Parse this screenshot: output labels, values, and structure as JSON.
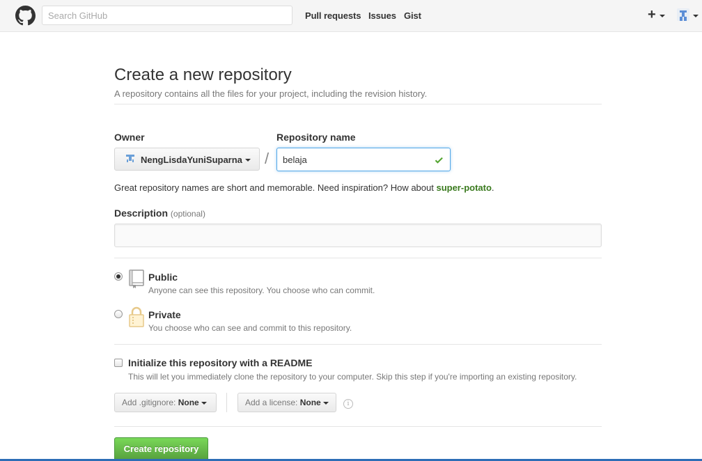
{
  "header": {
    "search_placeholder": "Search GitHub",
    "nav": {
      "pull_requests": "Pull requests",
      "issues": "Issues",
      "gist": "Gist"
    },
    "new_menu": "+"
  },
  "page": {
    "title": "Create a new repository",
    "subtitle": "A repository contains all the files for your project, including the revision history."
  },
  "form": {
    "owner_label": "Owner",
    "owner_value": "NengLisdaYuniSuparna",
    "separator": "/",
    "repo_label": "Repository name",
    "repo_value": "belaja",
    "hint_text": "Great repository names are short and memorable. Need inspiration? How about ",
    "hint_suggestion": "super-potato",
    "hint_end": ".",
    "description_label": "Description",
    "description_optional": "(optional)",
    "description_value": ""
  },
  "visibility": {
    "selected": "public",
    "public_title": "Public",
    "public_desc": "Anyone can see this repository. You choose who can commit.",
    "private_title": "Private",
    "private_desc": "You choose who can see and commit to this repository."
  },
  "init": {
    "checked": false,
    "readme_title": "Initialize this repository with a README",
    "readme_desc": "This will let you immediately clone the repository to your computer. Skip this step if you're importing an existing repository.",
    "gitignore_label": "Add .gitignore:",
    "gitignore_value": "None",
    "license_label": "Add a license:",
    "license_value": "None",
    "info_glyph": "i"
  },
  "submit": {
    "label": "Create repository"
  },
  "colors": {
    "accent_green": "#569e3d",
    "focus_blue": "#51a7e8",
    "suggestion_green": "#3a7a1e"
  }
}
